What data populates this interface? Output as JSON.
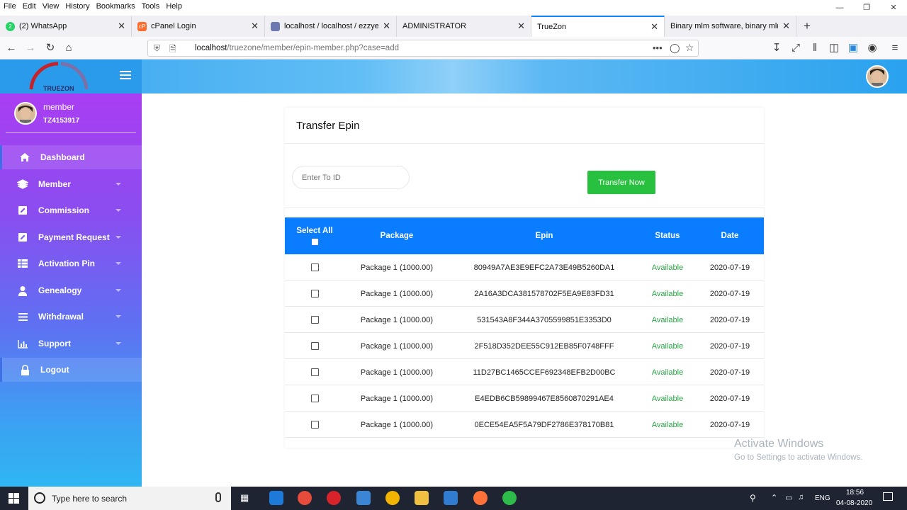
{
  "browser": {
    "menu": [
      "File",
      "Edit",
      "View",
      "History",
      "Bookmarks",
      "Tools",
      "Help"
    ],
    "tabs": [
      {
        "label": "(2) WhatsApp",
        "icon": "whatsapp-icon",
        "color": "#25d366"
      },
      {
        "label": "cPanel Login",
        "icon": "cpanel-icon",
        "color": "#ff6c2c"
      },
      {
        "label": "localhost / localhost / ezzyeam",
        "icon": "phpmyadmin-icon",
        "color": "#6c78af"
      },
      {
        "label": "ADMINISTRATOR",
        "icon": "",
        "color": ""
      },
      {
        "label": "TrueZon",
        "icon": "",
        "color": ""
      },
      {
        "label": "Binary mlm software, binary mlm so",
        "icon": "",
        "color": ""
      }
    ],
    "url_host": "localhost",
    "url_path": "/truezone/member/epin-member.php?case=add"
  },
  "brand": {
    "logo_text": "TRUEZON",
    "accent": "#28c13f",
    "header_blue": "#0a7cff"
  },
  "user": {
    "name": "member",
    "id": "TZ4153917"
  },
  "sidebar": {
    "items": [
      {
        "label": "Dashboard",
        "icon": "home-icon"
      },
      {
        "label": "Member",
        "icon": "layers-icon"
      },
      {
        "label": "Commission",
        "icon": "edit-icon"
      },
      {
        "label": "Payment Request",
        "icon": "edit-icon"
      },
      {
        "label": "Activation Pin",
        "icon": "grid-icon"
      },
      {
        "label": "Genealogy",
        "icon": "user-icon"
      },
      {
        "label": "Withdrawal",
        "icon": "list-icon"
      },
      {
        "label": "Support",
        "icon": "bar-chart-icon"
      },
      {
        "label": "Logout",
        "icon": "lock-icon"
      }
    ]
  },
  "card": {
    "title": "Transfer Epin",
    "to_id_placeholder": "Enter To ID",
    "transfer_button": "Transfer Now"
  },
  "table": {
    "headers": {
      "select_all": "Select All",
      "package": "Package",
      "epin": "Epin",
      "status": "Status",
      "date": "Date"
    },
    "rows": [
      {
        "package": "Package 1 (1000.00)",
        "epin": "80949A7AE3E9EFC2A73E49B5260DA1",
        "status": "Available",
        "date": "2020-07-19"
      },
      {
        "package": "Package 1 (1000.00)",
        "epin": "2A16A3DCA381578702F5EA9E83FD31",
        "status": "Available",
        "date": "2020-07-19"
      },
      {
        "package": "Package 1 (1000.00)",
        "epin": "531543A8F344A3705599851E3353D0",
        "status": "Available",
        "date": "2020-07-19"
      },
      {
        "package": "Package 1 (1000.00)",
        "epin": "2F518D352DEE55C912EB85F0748FFF",
        "status": "Available",
        "date": "2020-07-19"
      },
      {
        "package": "Package 1 (1000.00)",
        "epin": "11D27BC1465CCEF692348EFB2D00BC",
        "status": "Available",
        "date": "2020-07-19"
      },
      {
        "package": "Package 1 (1000.00)",
        "epin": "E4EDB6CB59899467E8560870291AE4",
        "status": "Available",
        "date": "2020-07-19"
      },
      {
        "package": "Package 1 (1000.00)",
        "epin": "0ECE54EA5F5A79DF2786E378170B81",
        "status": "Available",
        "date": "2020-07-19"
      }
    ]
  },
  "watermark": {
    "line1": "Activate Windows",
    "line2": "Go to Settings to activate Windows."
  },
  "taskbar": {
    "search_placeholder": "Type here to search",
    "lang": "ENG",
    "time": "18:56",
    "date": "04-08-2020"
  }
}
